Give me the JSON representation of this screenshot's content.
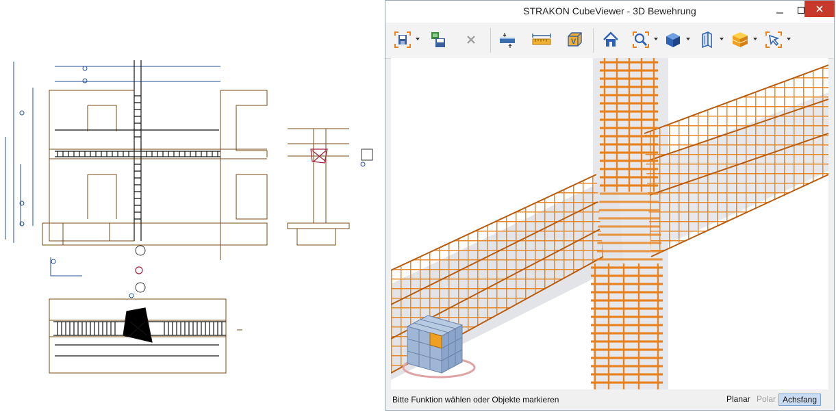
{
  "window": {
    "title": "STRAKON CubeViewer - 3D Bewehrung"
  },
  "toolbar": {
    "buttons": [
      {
        "name": "save",
        "icon": "save-icon",
        "dropdown": true
      },
      {
        "name": "export",
        "icon": "export-icon",
        "dropdown": false
      },
      {
        "name": "delete",
        "icon": "delete-icon",
        "dropdown": false
      },
      {
        "name": "section",
        "icon": "section-icon",
        "dropdown": false
      },
      {
        "name": "measure",
        "icon": "ruler-icon",
        "dropdown": false
      },
      {
        "name": "view-cube",
        "icon": "view-box-icon",
        "dropdown": false
      },
      {
        "name": "home",
        "icon": "home-icon",
        "dropdown": false
      },
      {
        "name": "zoom",
        "icon": "zoom-icon",
        "dropdown": true
      },
      {
        "name": "render",
        "icon": "solid-icon",
        "dropdown": true
      },
      {
        "name": "clipping",
        "icon": "clip-plane-icon",
        "dropdown": true
      },
      {
        "name": "layers",
        "icon": "layers-icon",
        "dropdown": true
      },
      {
        "name": "select",
        "icon": "select-icon",
        "dropdown": true
      }
    ]
  },
  "status": {
    "message": "Bitte Funktion wählen oder Objekte markieren",
    "planar": "Planar",
    "polar": "Polar",
    "achsfang": "Achsfang"
  },
  "colors": {
    "rebar": "#e8821f",
    "rebar_dark": "#b85c0f",
    "concrete": "#e4e6ea",
    "drawing_line": "#7a4a12",
    "drawing_blue": "#1f4e9a",
    "active": "#c9dcf2"
  }
}
